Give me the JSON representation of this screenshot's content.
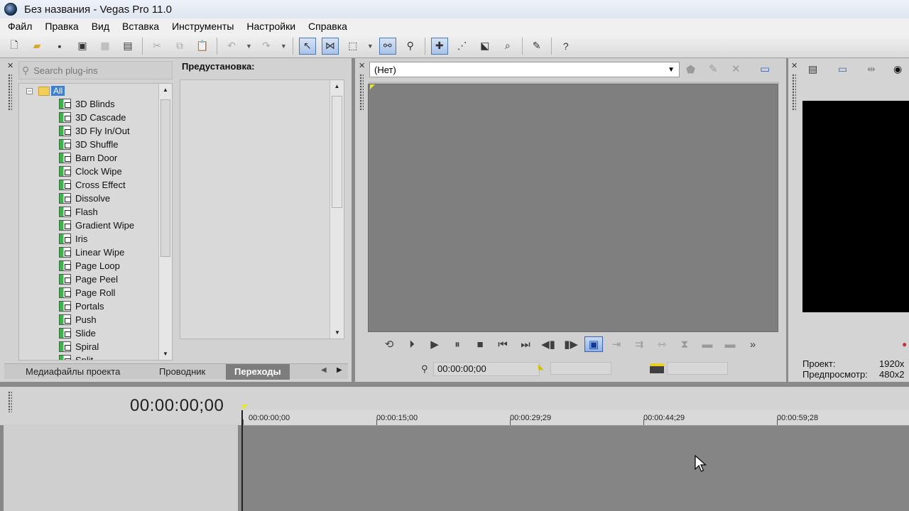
{
  "window": {
    "title": "Без названия - Vegas Pro 11.0"
  },
  "menu": [
    "Файл",
    "Правка",
    "Вид",
    "Вставка",
    "Инструменты",
    "Настройки",
    "Справка"
  ],
  "explorer": {
    "search_placeholder": "Search plug-ins",
    "root_label": "All",
    "items": [
      "3D Blinds",
      "3D Cascade",
      "3D Fly In/Out",
      "3D Shuffle",
      "Barn Door",
      "Clock Wipe",
      "Cross Effect",
      "Dissolve",
      "Flash",
      "Gradient Wipe",
      "Iris",
      "Linear Wipe",
      "Page Loop",
      "Page Peel",
      "Page Roll",
      "Portals",
      "Push",
      "Slide",
      "Spiral",
      "Split"
    ],
    "preset_label": "Предустановка:",
    "tabs": [
      "Медиафайлы проекта",
      "Проводник",
      "Переходы"
    ],
    "active_tab": "Переходы"
  },
  "trimmer": {
    "selected": "(Нет)",
    "timecode": "00:00:00;00"
  },
  "preview": {
    "project_label": "Проект:",
    "project_value": "1920x",
    "preview_label": "Предпросмотр:",
    "preview_value": "480x2"
  },
  "timeline": {
    "time": "00:00:00;00",
    "ruler": [
      "00:00:00;00",
      "00:00:15;00",
      "00:00:29;29",
      "00:00:44;29",
      "00:00:59;28"
    ]
  }
}
